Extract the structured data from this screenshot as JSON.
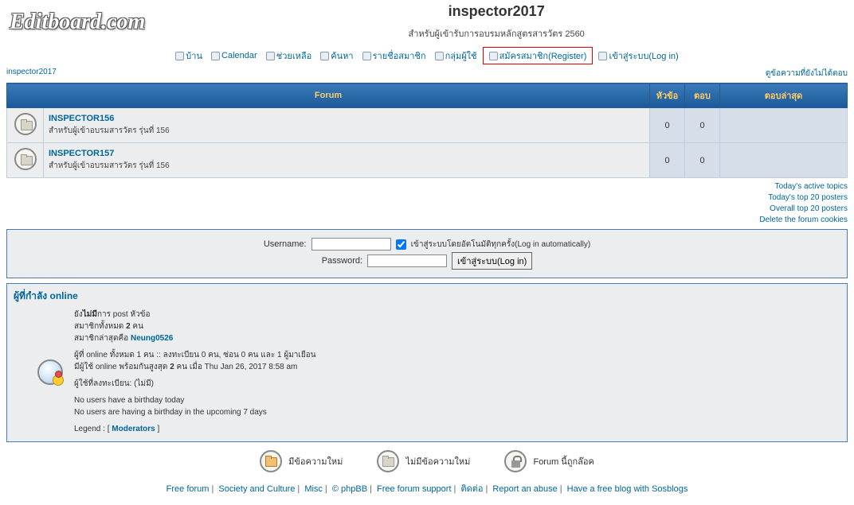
{
  "logo": "Editboard.com",
  "site": {
    "title": "inspector2017",
    "desc": "สำหรับผู้เข้ารับการอบรมหลักสูตรสารวัตร 2560"
  },
  "nav": {
    "home": "บ้าน",
    "calendar": "Calendar",
    "faq": "ช่วยเหลือ",
    "search": "ค้นหา",
    "memberlist": "รายชื่อสมาชิก",
    "groups": "กลุ่มผู้ใช้",
    "register": "สมัครสมาชิก(Register)",
    "login": "เข้าสู่ระบบ(Log in)"
  },
  "breadcrumb": "inspector2017",
  "unanswered": "ดูข้อความที่ยังไม่ได้ตอบ",
  "headers": {
    "forum": "Forum",
    "topics": "หัวข้อ",
    "posts": "ตอบ",
    "last": "ตอบล่าสุด"
  },
  "forums": [
    {
      "name": "INSPECTOR156",
      "desc": "สำหรับผู้เข้าอบรมสารวัตร รุ่นที่ 156",
      "topics": "0",
      "posts": "0"
    },
    {
      "name": "INSPECTOR157",
      "desc": "สำหรับผู้เข้าอบรมสารวัตร รุ่นที่ 156",
      "topics": "0",
      "posts": "0"
    }
  ],
  "sidelinks": {
    "active": "Today's active topics",
    "top20": "Today's top 20 posters",
    "overall": "Overall top 20 posters",
    "cookies": "Delete the forum cookies"
  },
  "login": {
    "username": "Username:",
    "password": "Password:",
    "auto": "เข้าสู่ระบบโดยอัตโนมัติทุกครั้ง(Log in automatically)",
    "submit": "เข้าสู่ระบบ(Log in)"
  },
  "online": {
    "title": "ผู้ที่กำลัง online",
    "l1a": "ยัง",
    "l1b": "ไม่มี",
    "l1c": "การ post หัวข้อ",
    "l2a": "สมาชิกทั้งหมด ",
    "l2b": "2",
    "l2c": " คน",
    "l3a": "สมาชิกล่าสุดคือ ",
    "l3user": "Neung0526",
    "l4": "ผู้ที่ online ทั้งหมด 1 คน :: ลงทะเบียน 0 คน, ซ่อน 0 คน และ 1 ผู้มาเยือน",
    "l5a": "มีผู้ใช้ online พร้อมกันสูงสุด ",
    "l5b": "2",
    "l5c": " คน เมื่อ Thu Jan 26, 2017 8:58 am",
    "l6": "ผู้ใช้ที่ลงทะเบียน: (ไม่มี)",
    "l7": "No users have a birthday today",
    "l8": "No users are having a birthday in the upcoming 7 days",
    "l9a": "Legend :   [ ",
    "l9b": "Moderators",
    "l9c": " ]"
  },
  "legend": {
    "new": "มีข้อความใหม่",
    "nonew": "ไม่มีข้อความใหม่",
    "locked": "Forum นี้ถูกล๊อค"
  },
  "footer": {
    "f1": "Free forum",
    "f2": "Society and Culture",
    "f3": "Misc",
    "f4": "© phpBB",
    "f5": "Free forum support",
    "f6": "ติดต่อ",
    "f7": "Report an abuse",
    "f8": "Have a free blog with Sosblogs"
  }
}
